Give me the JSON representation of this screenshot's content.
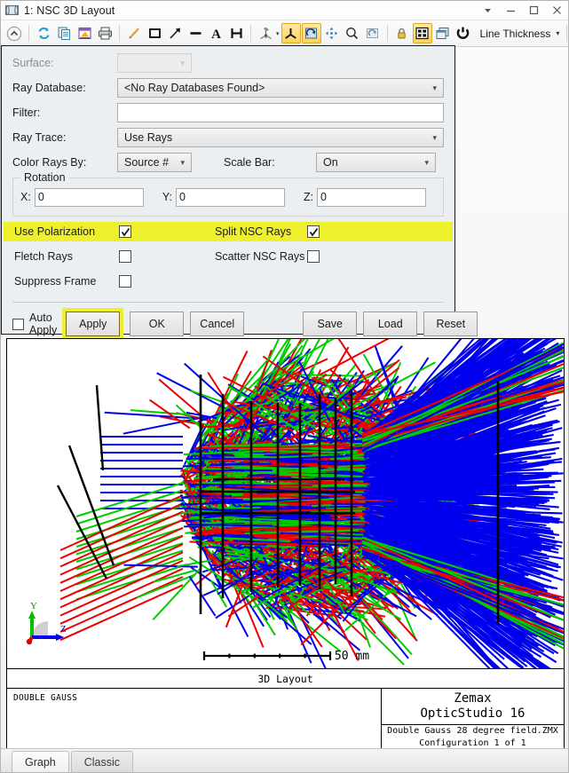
{
  "window": {
    "title": "1: NSC 3D Layout",
    "icon": "layout-window-icon",
    "controls": {
      "menu": "chevron-down-icon",
      "minimize": "minimize-icon",
      "maximize": "maximize-icon",
      "close": "close-icon"
    }
  },
  "toolbar": {
    "line_thickness_label": "Line Thickness",
    "buttons": [
      {
        "name": "collapse-icon",
        "active": false
      },
      {
        "name": "refresh-icon",
        "active": false
      },
      {
        "name": "copy-icon",
        "active": false
      },
      {
        "name": "save-image-icon",
        "active": false
      },
      {
        "name": "print-icon",
        "active": false
      },
      {
        "name": "pencil-line-icon",
        "active": false
      },
      {
        "name": "rectangle-icon",
        "active": false
      },
      {
        "name": "arrow-icon",
        "active": false
      },
      {
        "name": "line-icon",
        "active": false
      },
      {
        "name": "text-annotation-icon",
        "active": false
      },
      {
        "name": "dimension-icon",
        "active": false
      },
      {
        "name": "view-orientation-icon",
        "active": false
      },
      {
        "name": "axis-tripod-icon",
        "active": true
      },
      {
        "name": "rotate-icon",
        "active": true
      },
      {
        "name": "pan-icon",
        "active": false
      },
      {
        "name": "zoom-icon",
        "active": false
      },
      {
        "name": "reset-view-icon",
        "active": false
      },
      {
        "name": "lock-icon",
        "active": false
      },
      {
        "name": "fit-window-icon",
        "active": true
      },
      {
        "name": "window-copy-icon",
        "active": false
      },
      {
        "name": "power-icon",
        "active": false
      },
      {
        "name": "help-icon",
        "active": false
      }
    ]
  },
  "settings": {
    "surface": {
      "label": "Surface:",
      "value": "",
      "disabled": true
    },
    "ray_database": {
      "label": "Ray Database:",
      "value": "<No Ray Databases Found>"
    },
    "filter": {
      "label": "Filter:",
      "value": ""
    },
    "ray_trace": {
      "label": "Ray Trace:",
      "value": "Use Rays"
    },
    "color_rays_by": {
      "label": "Color Rays By:",
      "value": "Source #"
    },
    "scale_bar": {
      "label": "Scale Bar:",
      "value": "On"
    },
    "rotation": {
      "legend": "Rotation",
      "x_label": "X:",
      "x_value": "0",
      "y_label": "Y:",
      "y_value": "0",
      "z_label": "Z:",
      "z_value": "0"
    },
    "checkboxes": {
      "use_polarization": {
        "label": "Use Polarization",
        "checked": true,
        "highlighted": true
      },
      "split_nsc_rays": {
        "label": "Split NSC Rays",
        "checked": true,
        "highlighted": true
      },
      "fletch_rays": {
        "label": "Fletch Rays",
        "checked": false,
        "highlighted": false
      },
      "scatter_nsc_rays": {
        "label": "Scatter NSC Rays",
        "checked": false,
        "highlighted": false
      },
      "suppress_frame": {
        "label": "Suppress Frame",
        "checked": false,
        "highlighted": false
      }
    },
    "auto_apply": {
      "label": "Auto Apply",
      "checked": false
    },
    "buttons": {
      "apply": "Apply",
      "ok": "OK",
      "cancel": "Cancel",
      "save": "Save",
      "load": "Load",
      "reset": "Reset"
    },
    "highlight_color": "#eef02e"
  },
  "graph": {
    "scale_bar_text": "50 mm",
    "scale_bar_divisions": 5,
    "title": "3D Layout",
    "lens_name": "DOUBLE GAUSS",
    "brand_line1": "Zemax",
    "brand_line2": "OpticStudio 16",
    "file_name": "Double Gauss 28 degree field.ZMX",
    "configuration": "Configuration 1 of 1",
    "axis_indicator": {
      "y_label": "Y",
      "z_label": "Z",
      "y_color": "#00c000",
      "z_color": "#0000ee",
      "x_color": "#e00000"
    },
    "ray_colors": {
      "source_1": "#0000ee",
      "source_2": "#00cc00",
      "source_3": "#ee0000",
      "geometry": "#000000"
    }
  },
  "tabs": [
    {
      "label": "Graph",
      "active": true
    },
    {
      "label": "Classic",
      "active": false
    }
  ]
}
